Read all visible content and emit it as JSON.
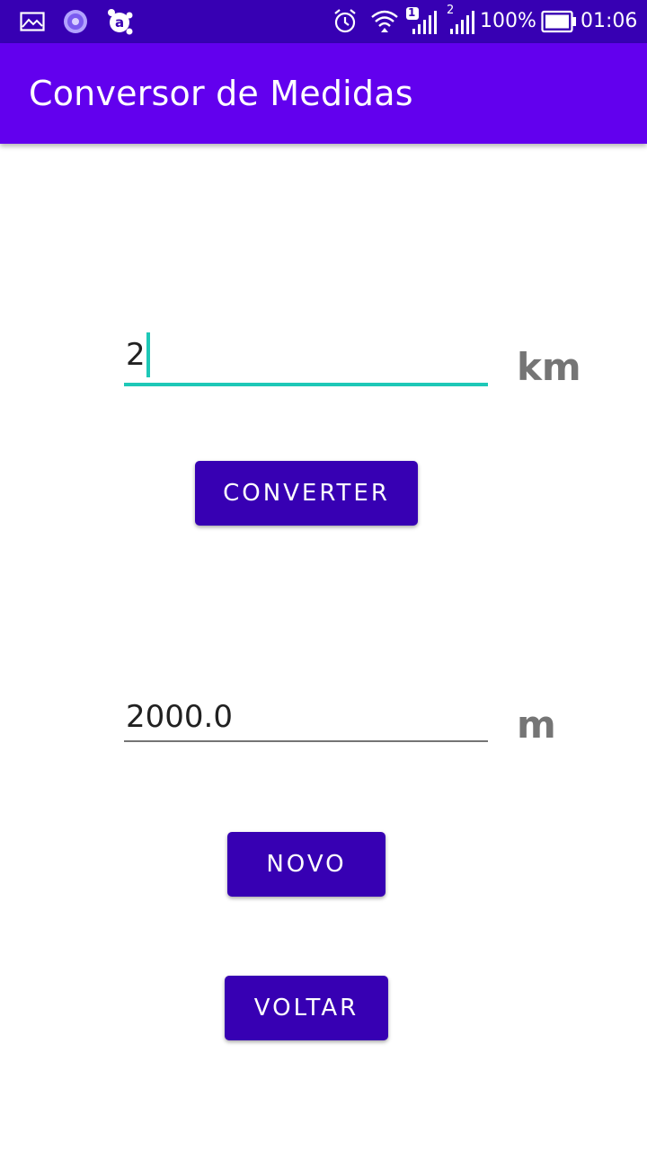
{
  "status_bar": {
    "icons": {
      "left": [
        "image-icon",
        "circle-app-icon",
        "avast-icon"
      ],
      "right": [
        "alarm-icon",
        "wifi-icon",
        "signal-sim1-icon",
        "signal-sim2-icon",
        "battery-icon"
      ]
    },
    "sim1_label": "1",
    "sim2_label": "2",
    "battery_percent": "100%",
    "time": "01:06",
    "color": "#3700B3"
  },
  "app_bar": {
    "title": "Conversor de Medidas",
    "color": "#6200EE"
  },
  "input": {
    "value": "2",
    "unit": "km",
    "accent_color": "#1EC8B7"
  },
  "convert_button": {
    "label": "CONVERTER"
  },
  "output": {
    "value": "2000.0",
    "unit": "m"
  },
  "new_button": {
    "label": "NOVO"
  },
  "back_button": {
    "label": "VOLTAR"
  },
  "button_color": "#3700B3"
}
